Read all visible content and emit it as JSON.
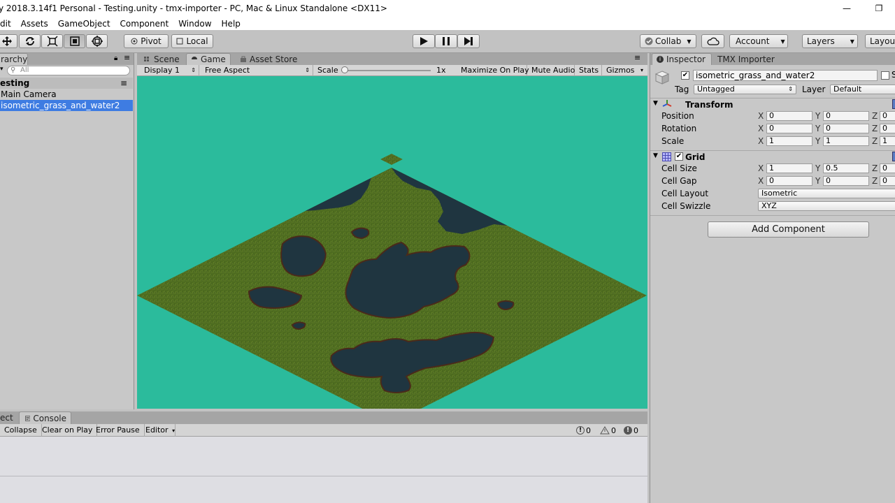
{
  "window": {
    "title": "y 2018.3.14f1 Personal - Testing.unity - tmx-importer - PC, Mac & Linux Standalone <DX11>",
    "minimize_glyph": "—",
    "restore_glyph": "❐"
  },
  "menu": [
    "dit",
    "Assets",
    "GameObject",
    "Component",
    "Window",
    "Help"
  ],
  "toolbar": {
    "pivot": "Pivot",
    "local": "Local",
    "collab": "Collab",
    "account": "Account",
    "layers": "Layers",
    "layout": "Layout"
  },
  "hierarchy": {
    "tab": "rarchy",
    "search_placeholder": "All",
    "scene": "esting",
    "items": [
      "Main Camera",
      "isometric_grass_and_water2"
    ]
  },
  "center_tabs": [
    "Scene",
    "Game",
    "Asset Store"
  ],
  "game_bar": {
    "display": "Display 1",
    "aspect": "Free Aspect",
    "scale_label": "Scale",
    "scale_value": "1x",
    "maximize": "Maximize On Play",
    "mute": "Mute Audio",
    "stats": "Stats",
    "gizmos": "Gizmos"
  },
  "console": {
    "tabs": [
      "ect",
      "Console"
    ],
    "buttons": [
      "Collapse",
      "Clear on Play",
      "Error Pause",
      "Editor"
    ],
    "counts": [
      "0",
      "0",
      "0"
    ]
  },
  "inspector": {
    "tabs": [
      "Inspector",
      "TMX Importer"
    ],
    "object_name": "isometric_grass_and_water2",
    "static_label": "S",
    "tag_label": "Tag",
    "tag_value": "Untagged",
    "layer_label": "Layer",
    "layer_value": "Default",
    "transform": {
      "title": "Transform",
      "rows": [
        {
          "label": "Position",
          "x": "0",
          "y": "0",
          "z": "0"
        },
        {
          "label": "Rotation",
          "x": "0",
          "y": "0",
          "z": "0"
        },
        {
          "label": "Scale",
          "x": "1",
          "y": "1",
          "z": "1"
        }
      ]
    },
    "grid": {
      "title": "Grid",
      "cell_size": {
        "label": "Cell Size",
        "x": "1",
        "y": "0.5",
        "z": "0"
      },
      "cell_gap": {
        "label": "Cell Gap",
        "x": "0",
        "y": "0",
        "z": "0"
      },
      "cell_layout_label": "Cell Layout",
      "cell_layout_value": "Isometric",
      "cell_swizzle_label": "Cell Swizzle",
      "cell_swizzle_value": "XYZ"
    },
    "axis_labels": [
      "X",
      "Y",
      "Z"
    ],
    "add_component": "Add Component"
  },
  "colors": {
    "game_background": "#2bbb9c",
    "grass": "#4d6b1f",
    "water": "#1f3540",
    "selection": "#3e7ce2"
  },
  "icons": [
    "move-tool-icon",
    "rotate-tool-icon",
    "scale-tool-icon",
    "rect-tool-icon",
    "transform-tool-icon",
    "play-icon",
    "pause-icon",
    "step-icon",
    "cloud-icon"
  ]
}
